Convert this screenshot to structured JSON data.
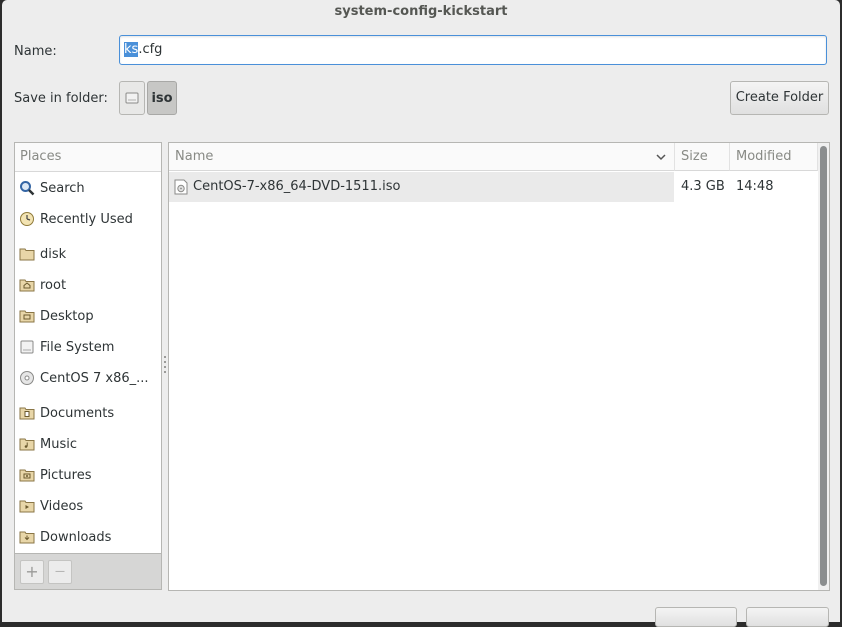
{
  "window": {
    "title": "system-config-kickstart"
  },
  "name_field": {
    "label": "Name:",
    "selected": "ks",
    "rest": ".cfg"
  },
  "save_folder": {
    "label": "Save in folder:",
    "path": [
      "iso"
    ]
  },
  "create_folder_button": "Create Folder",
  "places": {
    "header": "Places",
    "items": [
      {
        "label": "Search",
        "icon": "search-icon"
      },
      {
        "label": "Recently Used",
        "icon": "recent-icon"
      },
      {
        "label": "disk",
        "icon": "folder-icon"
      },
      {
        "label": "root",
        "icon": "home-folder-icon"
      },
      {
        "label": "Desktop",
        "icon": "desktop-folder-icon"
      },
      {
        "label": "File System",
        "icon": "drive-icon"
      },
      {
        "label": "CentOS 7 x86_...",
        "icon": "disc-icon"
      },
      {
        "label": "Documents",
        "icon": "documents-folder-icon"
      },
      {
        "label": "Music",
        "icon": "music-folder-icon"
      },
      {
        "label": "Pictures",
        "icon": "pictures-folder-icon"
      },
      {
        "label": "Videos",
        "icon": "videos-folder-icon"
      },
      {
        "label": "Downloads",
        "icon": "downloads-folder-icon"
      }
    ],
    "add_symbol": "+",
    "remove_symbol": "—"
  },
  "file_list": {
    "columns": {
      "name": "Name",
      "size": "Size",
      "modified": "Modified"
    },
    "rows": [
      {
        "name": "CentOS-7-x86_64-DVD-1511.iso",
        "size": "4.3 GB",
        "modified": "14:48",
        "icon": "disc-image-icon"
      }
    ]
  },
  "colors": {
    "selection": "#4a90d9",
    "window_bg": "#ededed"
  }
}
